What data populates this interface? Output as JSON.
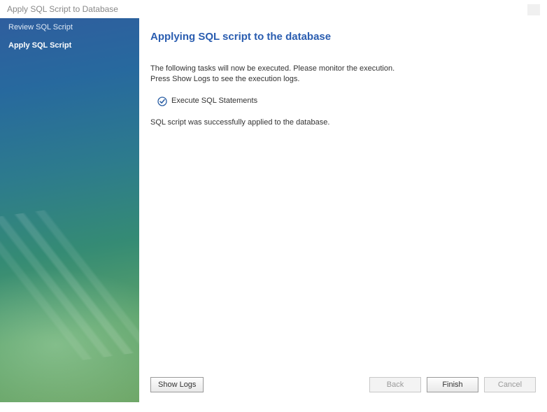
{
  "window": {
    "title": "Apply SQL Script to Database"
  },
  "sidebar": {
    "steps": [
      {
        "label": "Review SQL Script",
        "active": false
      },
      {
        "label": "Apply SQL Script",
        "active": true
      }
    ]
  },
  "main": {
    "heading": "Applying SQL script to the database",
    "intro_line1": "The following tasks will now be executed. Please monitor the execution.",
    "intro_line2": "Press Show Logs to see the execution logs.",
    "task_label": "Execute SQL Statements",
    "result_text": "SQL script was successfully applied to the database."
  },
  "buttons": {
    "show_logs": "Show Logs",
    "back": "Back",
    "finish": "Finish",
    "cancel": "Cancel"
  },
  "icons": {
    "task_status": "check-complete"
  }
}
